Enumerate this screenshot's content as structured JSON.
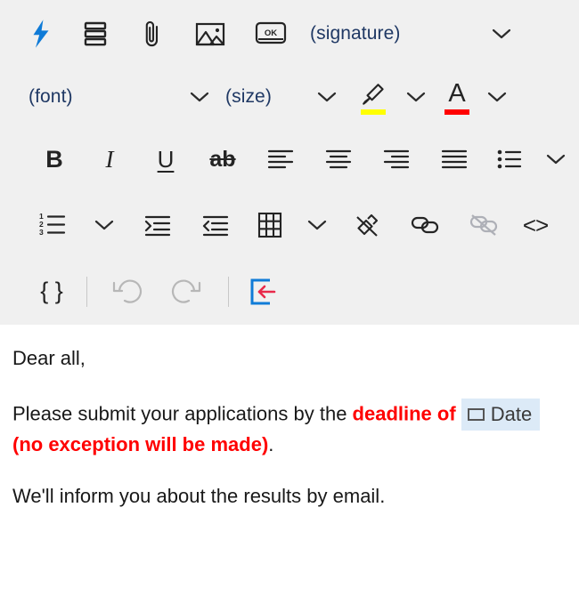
{
  "toolbar": {
    "rows": [
      {
        "name": "row-insert",
        "items": [
          {
            "icon": "lightning-bolt-icon",
            "label": ""
          },
          {
            "icon": "stacked-blocks-icon",
            "label": ""
          },
          {
            "icon": "paperclip-icon",
            "label": ""
          },
          {
            "icon": "picture-icon",
            "label": ""
          },
          {
            "icon": "ok-key-icon",
            "label": ""
          },
          {
            "icon": "signature-label",
            "label": "(signature)"
          },
          {
            "icon": "chevron-down-icon",
            "label": ""
          }
        ]
      },
      {
        "name": "row-font",
        "items": [
          {
            "icon": "font-label",
            "label": "(font)"
          },
          {
            "icon": "chevron-down-icon",
            "label": ""
          },
          {
            "icon": "size-label",
            "label": "(size)"
          },
          {
            "icon": "chevron-down-icon",
            "label": ""
          },
          {
            "icon": "highlight-icon",
            "label": ""
          },
          {
            "icon": "chevron-down-icon",
            "label": ""
          },
          {
            "icon": "font-color-icon",
            "label": ""
          },
          {
            "icon": "chevron-down-icon",
            "label": ""
          }
        ]
      },
      {
        "name": "row-format",
        "items": [
          {
            "icon": "bold-icon",
            "label": "B"
          },
          {
            "icon": "italic-icon",
            "label": "I"
          },
          {
            "icon": "underline-icon",
            "label": "U"
          },
          {
            "icon": "strikethrough-icon",
            "label": "ab"
          },
          {
            "icon": "align-left-icon",
            "label": ""
          },
          {
            "icon": "align-center-icon",
            "label": ""
          },
          {
            "icon": "align-right-icon",
            "label": ""
          },
          {
            "icon": "align-justify-icon",
            "label": ""
          },
          {
            "icon": "bulleted-list-icon",
            "label": ""
          },
          {
            "icon": "chevron-down-icon",
            "label": ""
          }
        ]
      },
      {
        "name": "row-lists",
        "items": [
          {
            "icon": "numbered-list-icon",
            "label": ""
          },
          {
            "icon": "chevron-down-icon",
            "label": ""
          },
          {
            "icon": "increase-indent-icon",
            "label": ""
          },
          {
            "icon": "decrease-indent-icon",
            "label": ""
          },
          {
            "icon": "table-icon",
            "label": ""
          },
          {
            "icon": "chevron-down-icon",
            "label": ""
          },
          {
            "icon": "clear-formatting-icon",
            "label": ""
          },
          {
            "icon": "link-icon",
            "label": ""
          },
          {
            "icon": "unlink-icon",
            "label": ""
          },
          {
            "icon": "code-icon",
            "label": "<>"
          }
        ]
      },
      {
        "name": "row-history",
        "items": [
          {
            "icon": "braces-icon",
            "label": "{ }"
          },
          {
            "icon": "separator",
            "label": ""
          },
          {
            "icon": "undo-icon",
            "label": ""
          },
          {
            "icon": "redo-icon",
            "label": ""
          },
          {
            "icon": "separator",
            "label": ""
          },
          {
            "icon": "insert-placeholder-icon",
            "label": ""
          }
        ]
      }
    ],
    "colors": {
      "accent_blue": "#0f7bd7",
      "highlight_yellow": "#ffff00",
      "font_color_red": "#ff0000",
      "insert_arrow_red": "#e8294a",
      "label_navy": "#1f3864",
      "toolbar_bg": "#f0f0f0",
      "icon_gray": "#242424"
    }
  },
  "message": {
    "greeting": "Dear all,",
    "body_line": {
      "prefix": "Please submit your applications by the ",
      "emphasis_1": "deadline of",
      "field_chip": "Date",
      "emphasis_2": "(no exception will be made)",
      "suffix": "."
    },
    "closing": "We'll inform you about the results by email."
  }
}
